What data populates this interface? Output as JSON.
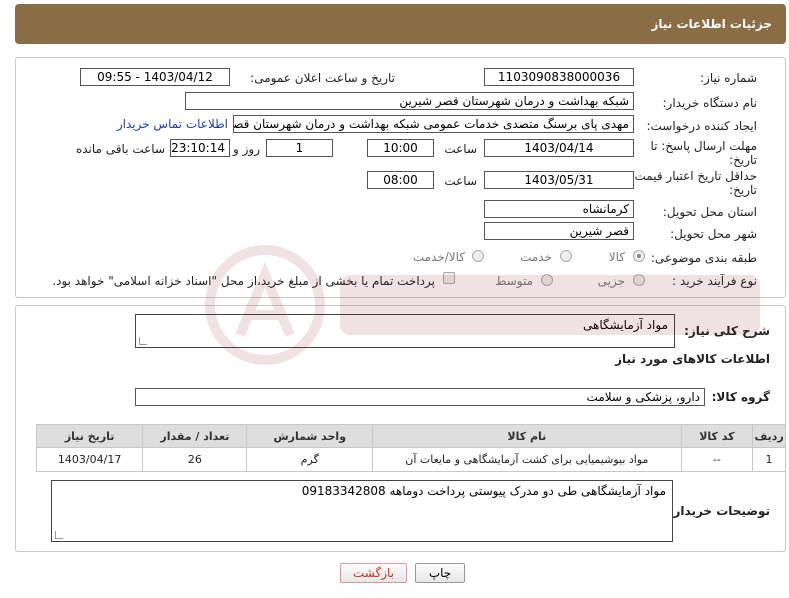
{
  "header": {
    "title": "جزئیات اطلاعات نیاز"
  },
  "form": {
    "need_number_label": "شماره نیاز:",
    "need_number": "1103090838000036",
    "announce_label": "تاریخ و ساعت اعلان عمومی:",
    "announce_value": "1403/04/12 - 09:55",
    "buyer_org_label": "نام دستگاه خریدار:",
    "buyer_org": "شبکه بهداشت و درمان شهرستان قصر شیرین",
    "creator_label": "ایجاد کننده درخواست:",
    "creator": "مهدی پای برسنگ متصدی خدمات عمومی شبکه بهداشت و درمان شهرستان قصر شیرین",
    "contact_link": "اطلاعات تماس خریدار",
    "reply_deadline_label_1": "مهلت ارسال پاسخ: تا",
    "reply_deadline_label_2": "تاریخ:",
    "reply_date": "1403/04/14",
    "time_label": "ساعت",
    "reply_time": "10:00",
    "days_value": "1",
    "days_label": "روز و",
    "remaining_time": "23:10:14",
    "remaining_label": "ساعت باقی مانده",
    "validity_label_1": "حداقل تاریخ اعتبار قیمت: تا",
    "validity_label_2": "تاریخ:",
    "validity_date": "1403/05/31",
    "validity_time": "08:00",
    "province_label": "استان محل تحویل:",
    "province": "کرمانشاه",
    "city_label": "شهر محل تحویل:",
    "city": "قصر شیرین",
    "category_label": "طبقه بندی موضوعی:",
    "category_options": [
      "کالا",
      "خدمت",
      "کالا/خدمت"
    ],
    "process_label": "نوع فرآیند خرید :",
    "process_options": [
      "جزیی",
      "متوسط"
    ],
    "treasury_note": "پرداخت تمام یا بخشی از مبلغ خرید،از محل \"اسناد خزانه اسلامی\" خواهد بود."
  },
  "details": {
    "summary_label": "شرح کلی نیاز:",
    "summary": "مواد آزمایشگاهی",
    "goods_info_title": "اطلاعات کالاهای مورد نیاز",
    "goods_group_label": "گروه کالا:",
    "goods_group": "دارو، پزشکی و سلامت",
    "table": {
      "headers": [
        "ردیف",
        "کد کالا",
        "نام کالا",
        "واحد شمارش",
        "تعداد / مقدار",
        "تاریخ نیاز"
      ],
      "rows": [
        [
          "1",
          "--",
          "مواد بیوشیمیایی برای کشت آزمایشگاهی و مایعات آن",
          "گرم",
          "26",
          "1403/04/17"
        ]
      ]
    },
    "buyer_notes_label": "توضیحات خریدار:",
    "buyer_notes": "مواد آزمایشگاهی طی دو مدرک پیوستی پرداخت دوماهه 09183342808"
  },
  "buttons": {
    "print": "چاپ",
    "back": "بازگشت"
  },
  "colors": {
    "header_bg": "#8b6d45",
    "table_header_bg": "#dedede",
    "back_btn_text": "#c0392b"
  }
}
